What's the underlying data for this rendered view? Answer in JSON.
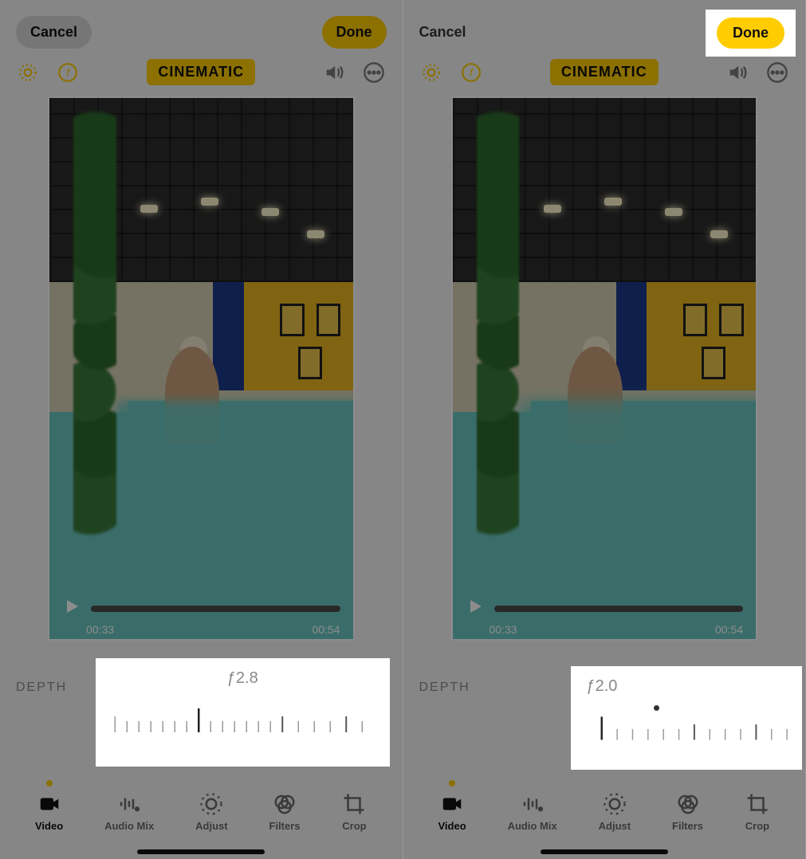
{
  "left": {
    "topbar": {
      "cancel": "Cancel",
      "done": "Done"
    },
    "mode_badge": "CINEMATIC",
    "playback": {
      "current": "00:33",
      "total": "00:54"
    },
    "depth": {
      "label": "DEPTH",
      "value": "ƒ2.8"
    },
    "tabs": {
      "video": "Video",
      "audio_mix": "Audio Mix",
      "adjust": "Adjust",
      "filters": "Filters",
      "crop": "Crop"
    }
  },
  "right": {
    "topbar": {
      "cancel": "Cancel",
      "done": "Done"
    },
    "mode_badge": "CINEMATIC",
    "playback": {
      "current": "00:33",
      "total": "00:54"
    },
    "depth": {
      "label": "DEPTH",
      "value": "ƒ2.0"
    },
    "tabs": {
      "video": "Video",
      "audio_mix": "Audio Mix",
      "adjust": "Adjust",
      "filters": "Filters",
      "crop": "Crop"
    }
  },
  "icons": {
    "live": "live-photo-icon",
    "fnum": "f-number-icon",
    "volume": "volume-icon",
    "more": "more-icon"
  }
}
